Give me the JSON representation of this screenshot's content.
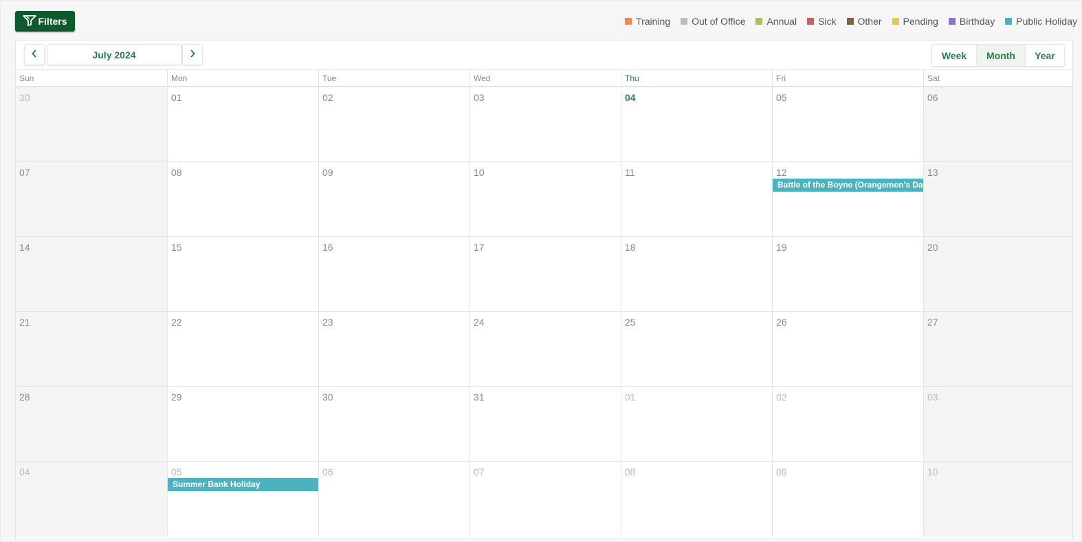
{
  "filters_label": "Filters",
  "legend": [
    {
      "label": "Training",
      "color": "#f4874b"
    },
    {
      "label": "Out of Office",
      "color": "#bdbdbd"
    },
    {
      "label": "Annual",
      "color": "#a8c45e"
    },
    {
      "label": "Sick",
      "color": "#c8605a"
    },
    {
      "label": "Other",
      "color": "#7d6149"
    },
    {
      "label": "Pending",
      "color": "#e3c95a"
    },
    {
      "label": "Birthday",
      "color": "#8c72c8"
    },
    {
      "label": "Public Holiday",
      "color": "#4bb3c0"
    }
  ],
  "toolbar": {
    "month_label": "July 2024",
    "prev_icon": "chevron-left-icon",
    "next_icon": "chevron-right-icon",
    "views": [
      "Week",
      "Month",
      "Year"
    ],
    "active_view": "Month"
  },
  "weekdays": [
    "Sun",
    "Mon",
    "Tue",
    "Wed",
    "Thu",
    "Fri",
    "Sat"
  ],
  "today_weekday": "Thu",
  "weeks": [
    [
      {
        "d": "30",
        "other": true
      },
      {
        "d": "01"
      },
      {
        "d": "02"
      },
      {
        "d": "03"
      },
      {
        "d": "04",
        "today": true
      },
      {
        "d": "05"
      },
      {
        "d": "06"
      }
    ],
    [
      {
        "d": "07"
      },
      {
        "d": "08"
      },
      {
        "d": "09"
      },
      {
        "d": "10"
      },
      {
        "d": "11"
      },
      {
        "d": "12",
        "event": "Battle of the Boyne (Orangemen's Day)"
      },
      {
        "d": "13"
      }
    ],
    [
      {
        "d": "14"
      },
      {
        "d": "15"
      },
      {
        "d": "16"
      },
      {
        "d": "17"
      },
      {
        "d": "18"
      },
      {
        "d": "19"
      },
      {
        "d": "20"
      }
    ],
    [
      {
        "d": "21"
      },
      {
        "d": "22"
      },
      {
        "d": "23"
      },
      {
        "d": "24"
      },
      {
        "d": "25"
      },
      {
        "d": "26"
      },
      {
        "d": "27"
      }
    ],
    [
      {
        "d": "28"
      },
      {
        "d": "29"
      },
      {
        "d": "30"
      },
      {
        "d": "31"
      },
      {
        "d": "01",
        "other": true
      },
      {
        "d": "02",
        "other": true
      },
      {
        "d": "03",
        "other": true
      }
    ],
    [
      {
        "d": "04",
        "other": true
      },
      {
        "d": "05",
        "other": true,
        "event": "Summer Bank Holiday"
      },
      {
        "d": "06",
        "other": true
      },
      {
        "d": "07",
        "other": true
      },
      {
        "d": "08",
        "other": true
      },
      {
        "d": "09",
        "other": true
      },
      {
        "d": "10",
        "other": true
      }
    ]
  ]
}
